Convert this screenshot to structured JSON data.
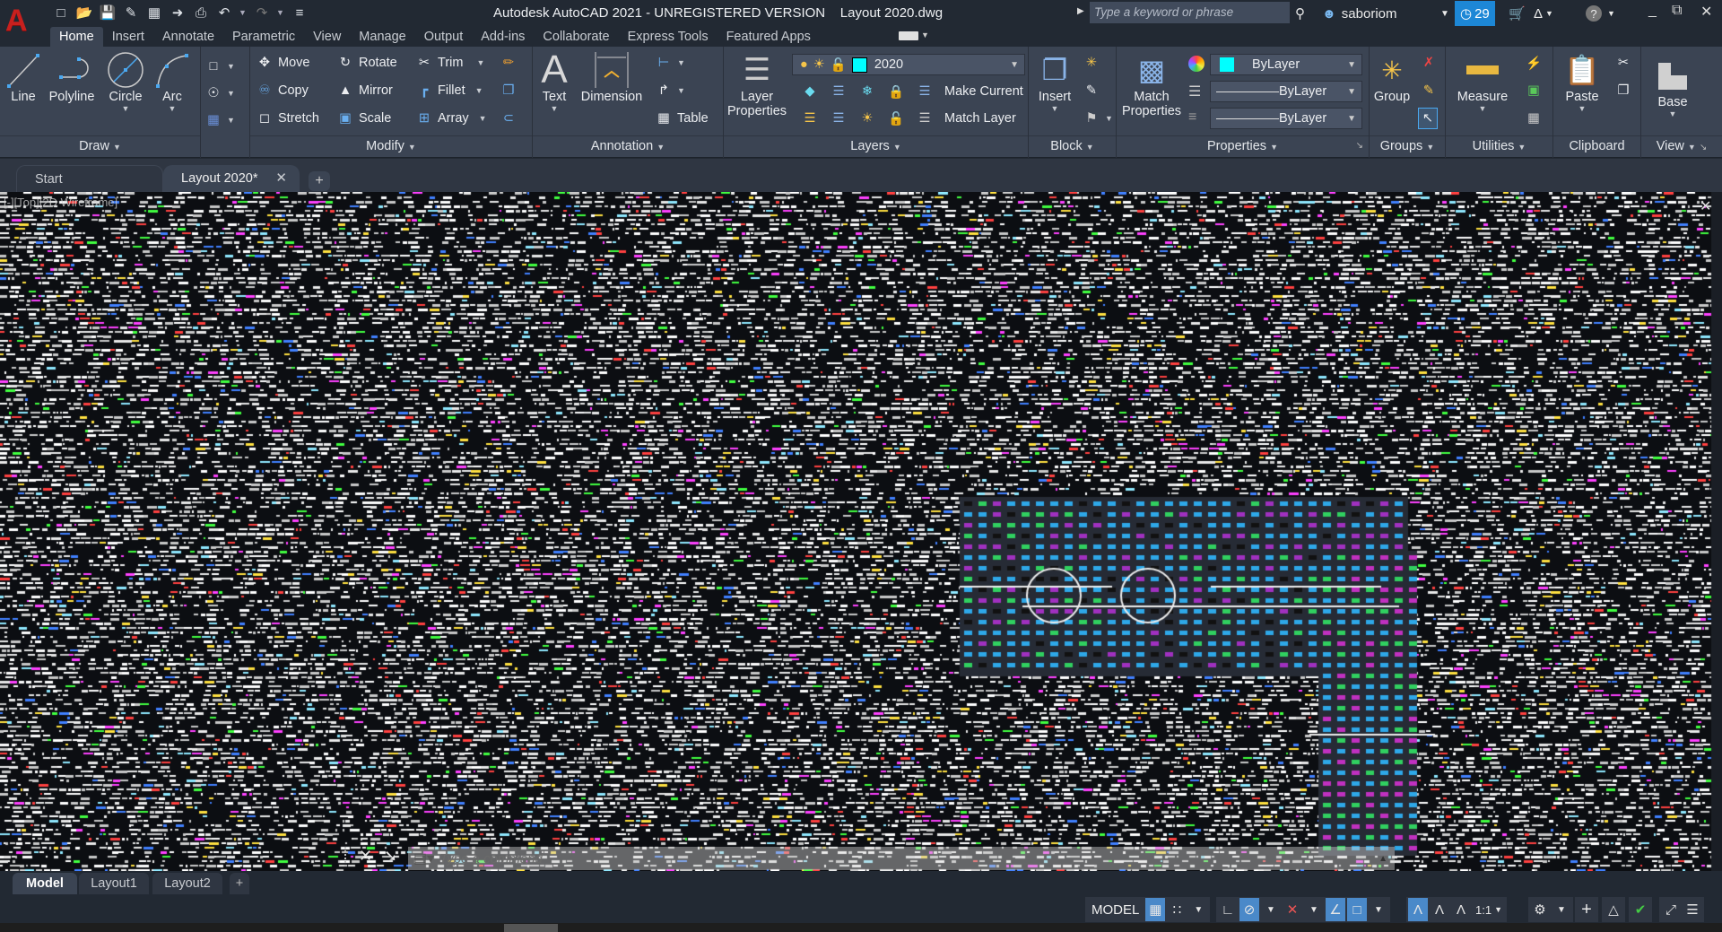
{
  "app": {
    "logo_letter": "A",
    "title": "Autodesk AutoCAD 2021 - UNREGISTERED VERSION    Layout 2020.dwg",
    "brand_color": "#c8201e",
    "quick_access": [
      "new-icon",
      "open-icon",
      "save-icon",
      "save-as-icon",
      "open-from-web-icon",
      "save-to-web-icon",
      "plot-icon",
      "undo-icon",
      "redo-icon",
      "customize-icon"
    ]
  },
  "titlebar": {
    "search_placeholder": "Type a keyword or phrase",
    "username": "saboriom",
    "timer_count": "29",
    "timer_color": "#1d87d6"
  },
  "ribbon_tabs": [
    "Home",
    "Insert",
    "Annotate",
    "Parametric",
    "View",
    "Manage",
    "Output",
    "Add-ins",
    "Collaborate",
    "Express Tools",
    "Featured Apps"
  ],
  "ribbon": {
    "draw": {
      "title": "Draw",
      "line": "Line",
      "polyline": "Polyline",
      "circle": "Circle",
      "arc": "Arc"
    },
    "modify": {
      "title": "Modify",
      "move": "Move",
      "rotate": "Rotate",
      "trim": "Trim",
      "copy": "Copy",
      "mirror": "Mirror",
      "fillet": "Fillet",
      "stretch": "Stretch",
      "scale": "Scale",
      "array": "Array"
    },
    "annotation": {
      "title": "Annotation",
      "text": "Text",
      "dimension": "Dimension",
      "table": "Table"
    },
    "layers": {
      "title": "Layers",
      "layer_properties_1": "Layer",
      "layer_properties_2": "Properties",
      "current_layer": "2020",
      "layer_color": "#00ffff",
      "make_current": "Make Current",
      "match_layer": "Match Layer"
    },
    "block": {
      "title": "Block",
      "insert": "Insert"
    },
    "properties": {
      "title": "Properties",
      "match_1": "Match",
      "match_2": "Properties",
      "color": "ByLayer",
      "lineweight": "ByLayer",
      "linetype": "ByLayer"
    },
    "groups": {
      "title": "Groups",
      "group": "Group"
    },
    "utilities": {
      "title": "Utilities",
      "measure": "Measure"
    },
    "clipboard": {
      "title": "Clipboard",
      "paste": "Paste"
    },
    "view": {
      "title": "View",
      "base": "Base"
    }
  },
  "doc_tabs": {
    "start": "Start",
    "active": "Layout 2020*"
  },
  "viewport": {
    "label": "[-][Top][2D Wireframe]"
  },
  "command_line": {
    "placeholder": "Type a command"
  },
  "layout_tabs": [
    "Model",
    "Layout1",
    "Layout2"
  ],
  "status_bar": {
    "mode": "MODEL",
    "scale": "1:1"
  }
}
